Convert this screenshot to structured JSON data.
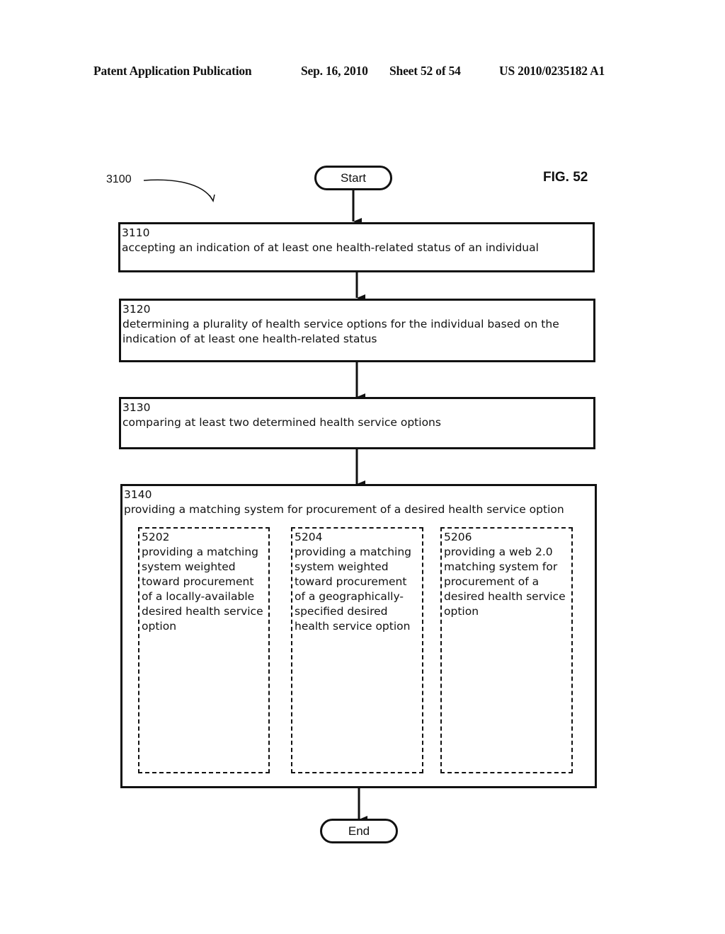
{
  "header": {
    "publication": "Patent Application Publication",
    "date": "Sep. 16, 2010",
    "sheet": "Sheet 52 of 54",
    "number": "US 2010/0235182 A1"
  },
  "figure": {
    "label": "FIG. 52",
    "reference": "3100"
  },
  "flow": {
    "start": "Start",
    "end": "End",
    "steps": [
      {
        "id": "3110",
        "text": "accepting an indication of at least one health-related status of an individual"
      },
      {
        "id": "3120",
        "text": "determining a plurality of health service options for the individual based on the indication of at least one health-related status"
      },
      {
        "id": "3130",
        "text": "comparing at least two determined health service options"
      },
      {
        "id": "3140",
        "text": "providing a matching system for procurement of a desired health service option"
      }
    ],
    "substeps": [
      {
        "id": "5202",
        "text": "providing a matching\nsystem weighted\ntoward procurement\nof a locally-available\ndesired health service\noption"
      },
      {
        "id": "5204",
        "text": "providing a matching\nsystem weighted\ntoward procurement\nof a geographically-\nspecified desired\nhealth service option"
      },
      {
        "id": "5206",
        "text": "providing a web 2.0\nmatching system for\nprocurement of a\ndesired health service\noption"
      }
    ]
  }
}
